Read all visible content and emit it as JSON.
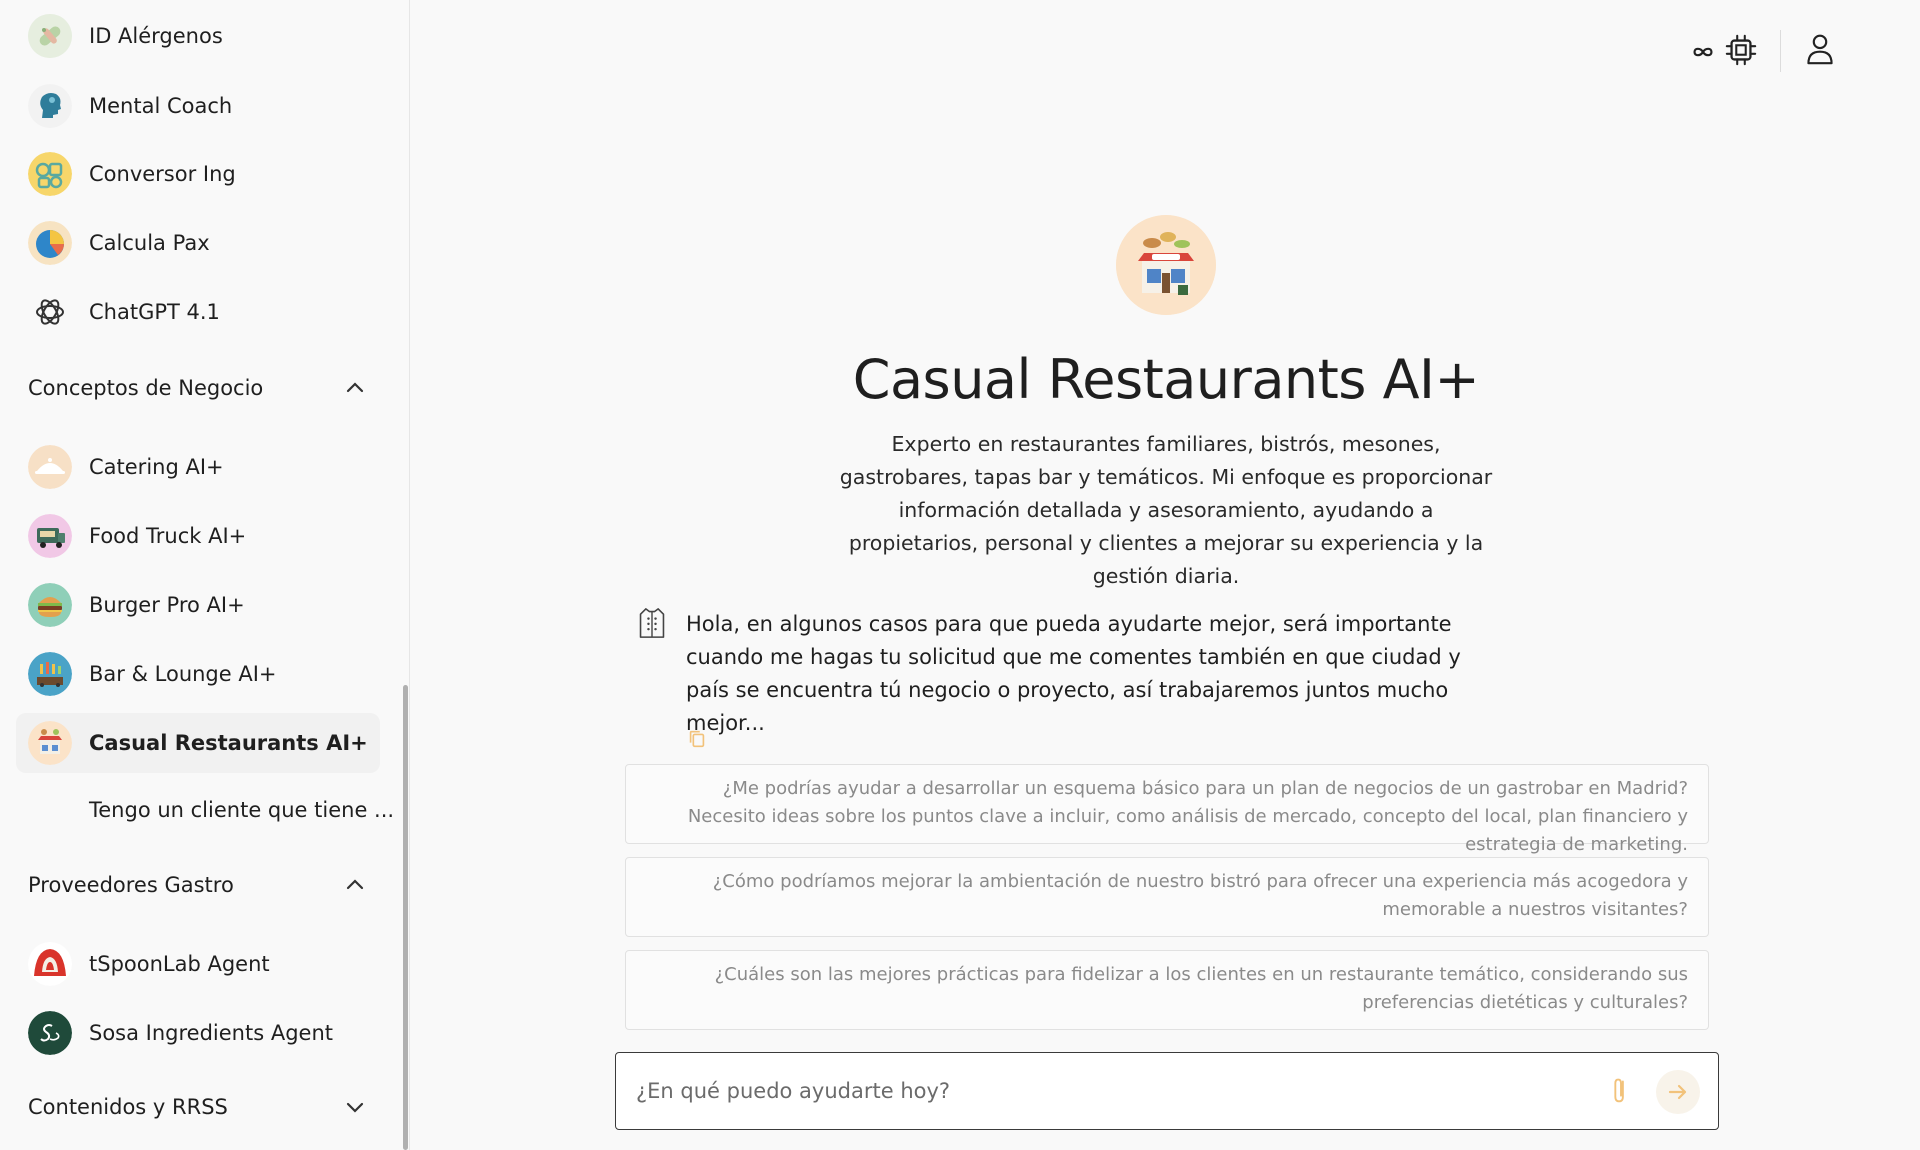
{
  "sidebar": {
    "items_top": [
      {
        "label": "ID Alérgenos",
        "icon": "allergen-pills-icon"
      },
      {
        "label": "Mental Coach",
        "icon": "head-silhouette-icon"
      },
      {
        "label": "Conversor Ing",
        "icon": "converter-icon"
      },
      {
        "label": "Calcula Pax",
        "icon": "pie-chart-icon"
      },
      {
        "label": "ChatGPT 4.1",
        "icon": "openai-logo-icon"
      }
    ],
    "section_business": {
      "label": "Conceptos de Negocio",
      "expanded": true
    },
    "items_business": [
      {
        "label": "Catering AI+",
        "icon": "catering-cloche-icon"
      },
      {
        "label": "Food Truck AI+",
        "icon": "food-truck-icon"
      },
      {
        "label": "Burger Pro AI+",
        "icon": "burger-icon"
      },
      {
        "label": "Bar & Lounge AI+",
        "icon": "bar-lounge-icon"
      },
      {
        "label": "Casual Restaurants AI+",
        "icon": "restaurant-icon",
        "active": true
      }
    ],
    "conversation_item": "Tengo un cliente que tiene ...",
    "section_suppliers": {
      "label": "Proveedores Gastro",
      "expanded": true
    },
    "items_suppliers": [
      {
        "label": "tSpoonLab Agent",
        "icon": "tspoonlab-logo-icon"
      },
      {
        "label": "Sosa Ingredients Agent",
        "icon": "sosa-logo-icon"
      }
    ],
    "section_content": {
      "label": "Contenidos y RRSS",
      "expanded": false
    }
  },
  "header": {
    "icons": [
      "infinity-icon",
      "chip-icon",
      "user-icon"
    ]
  },
  "main": {
    "title": "Casual Restaurants AI+",
    "description": "Experto en restaurantes familiares, bistrós, mesones, gastrobares, tapas bar y temáticos. Mi enfoque es proporcionar información detallada y asesoramiento, ayudando a propietarios, personal y clientes a mejorar su experiencia y la gestión diaria.",
    "greeting": "Hola, en algunos casos para que pueda ayudarte mejor, será importante cuando me hagas tu solicitud que me comentes también en que ciudad y país se encuentra tú negocio o proyecto, así trabajaremos juntos mucho mejor...",
    "suggestions": [
      "¿Me podrías ayudar a desarrollar un esquema básico para un plan de negocios de un gastrobar en Madrid? Necesito ideas sobre los puntos clave a incluir, como análisis de mercado, concepto del local, plan financiero y estrategia de marketing.",
      "¿Cómo podríamos mejorar la ambientación de nuestro bistró para ofrecer una experiencia más acogedora y memorable a nuestros visitantes?",
      "¿Cuáles son las mejores prácticas para fidelizar a los clientes en un restaurante temático, considerando sus preferencias dietéticas y culturales?"
    ],
    "input_placeholder": "¿En qué puedo ayudarte hoy?"
  },
  "colors": {
    "accent": "#f2a64a",
    "border": "#e1e1e1",
    "text": "#1f1f1f",
    "muted": "#8a8a8a"
  }
}
